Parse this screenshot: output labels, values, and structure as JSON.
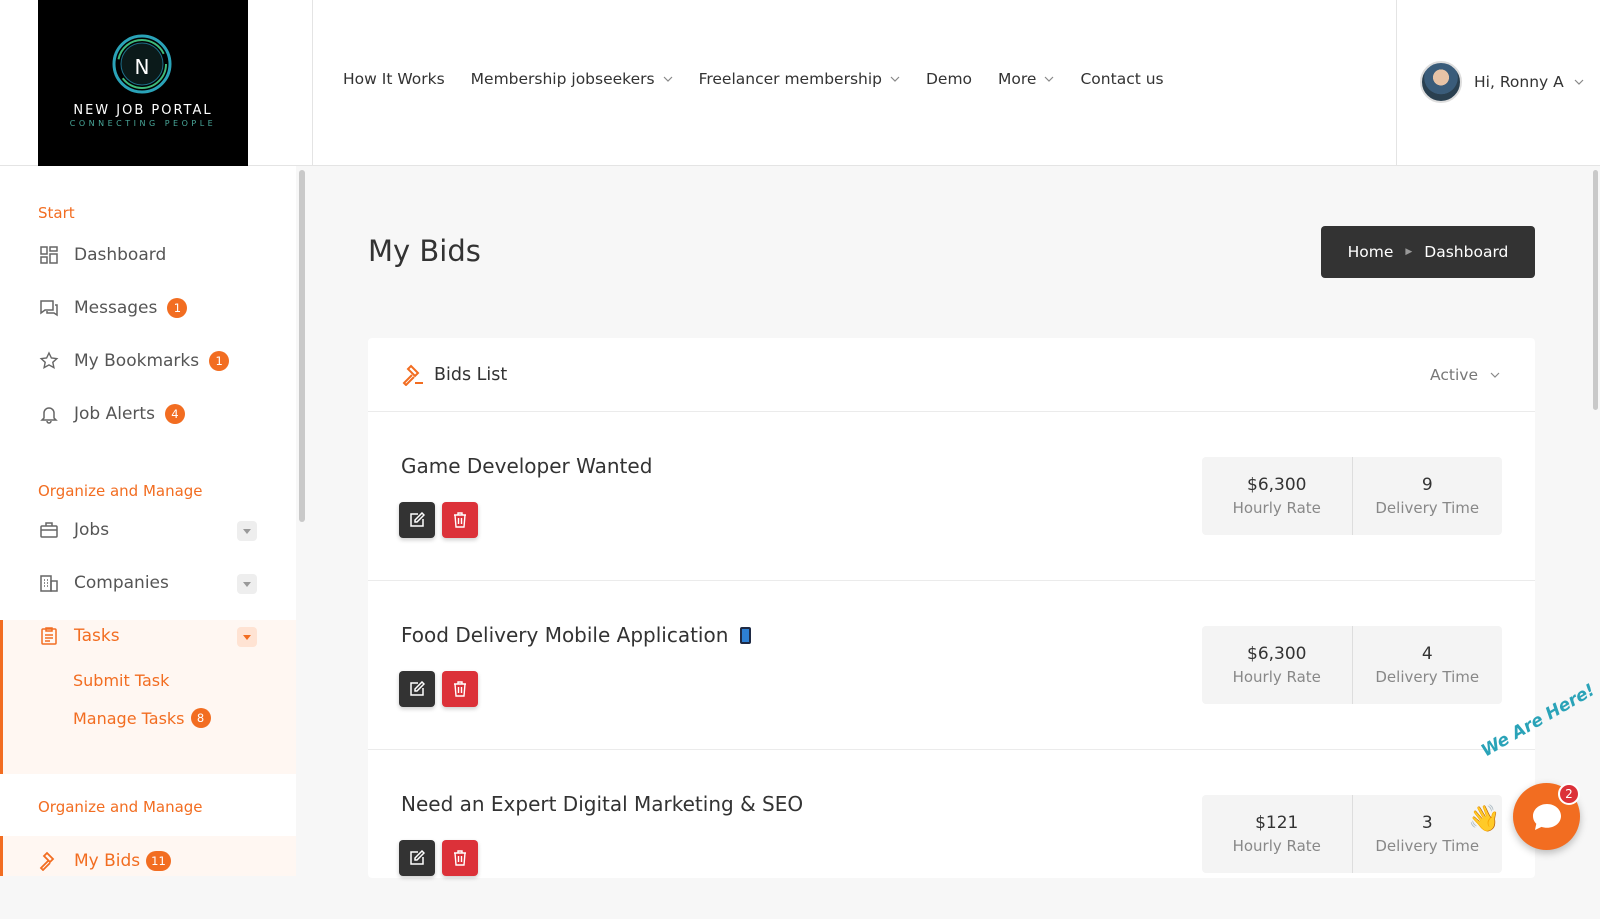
{
  "brand": {
    "initial": "N",
    "name": "NEW JOB PORTAL",
    "tagline": "CONNECTING PEOPLE"
  },
  "nav": {
    "items": [
      {
        "label": "How It Works",
        "dropdown": false
      },
      {
        "label": "Membership jobseekers",
        "dropdown": true
      },
      {
        "label": "Freelancer membership",
        "dropdown": true
      },
      {
        "label": "Demo",
        "dropdown": false
      },
      {
        "label": "More",
        "dropdown": true
      },
      {
        "label": "Contact us",
        "dropdown": false
      }
    ]
  },
  "user": {
    "greeting": "Hi, Ronny A"
  },
  "sidebar": {
    "section_start": "Start",
    "dashboard": "Dashboard",
    "messages": {
      "label": "Messages",
      "badge": "1"
    },
    "bookmarks": {
      "label": "My Bookmarks",
      "badge": "1"
    },
    "alerts": {
      "label": "Job Alerts",
      "badge": "4"
    },
    "section_organize": "Organize and Manage",
    "jobs": "Jobs",
    "companies": "Companies",
    "tasks": {
      "label": "Tasks",
      "submit": "Submit Task",
      "manage": "Manage Tasks",
      "manage_badge": "8"
    },
    "section_organize_2": "Organize and Manage",
    "mybids": {
      "label": "My Bids",
      "badge": "11"
    }
  },
  "page": {
    "title": "My Bids"
  },
  "breadcrumb": {
    "home": "Home",
    "current": "Dashboard"
  },
  "bids": {
    "list_title": "Bids List",
    "filter": "Active",
    "items": [
      {
        "title": "Game Developer Wanted",
        "rate": "$6,300",
        "rate_label": "Hourly Rate",
        "delivery": "9",
        "delivery_label": "Delivery Time"
      },
      {
        "title": "Food Delivery Mobile Application",
        "rate": "$6,300",
        "rate_label": "Hourly Rate",
        "delivery": "4",
        "delivery_label": "Delivery Time"
      },
      {
        "title": "Need an Expert Digital Marketing & SEO",
        "rate": "$121",
        "rate_label": "Hourly Rate",
        "delivery": "3",
        "delivery_label": "Delivery Time"
      }
    ]
  },
  "chat": {
    "tagline": "We Are Here!",
    "badge": "2"
  },
  "colors": {
    "accent": "#f26d21",
    "dark": "#333333",
    "danger": "#dc3139"
  }
}
